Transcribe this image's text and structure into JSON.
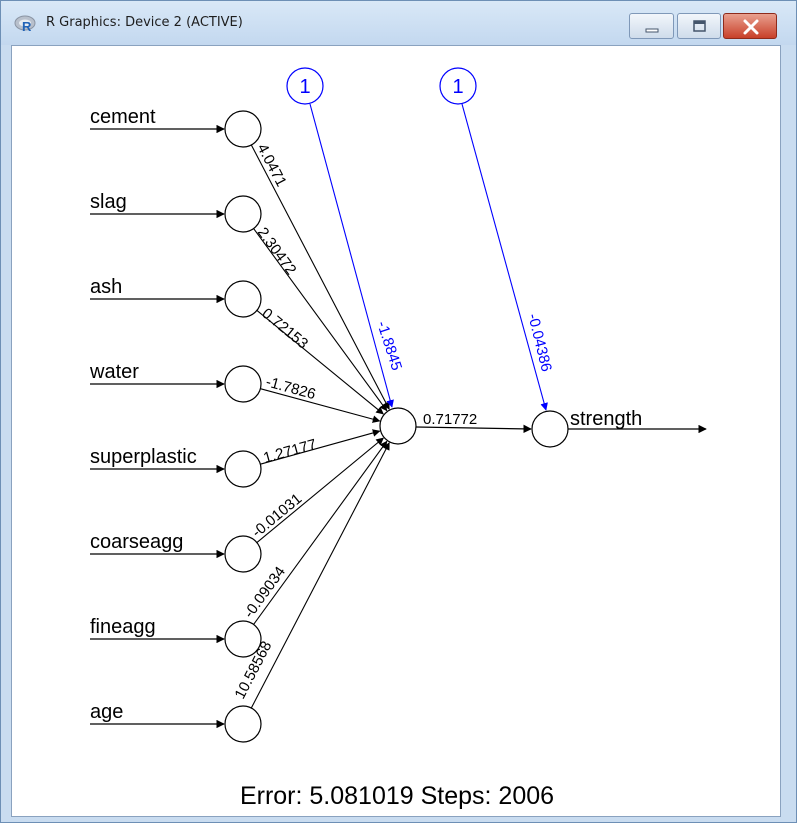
{
  "window": {
    "title": "R Graphics: Device 2 (ACTIVE)",
    "app_icon": "r-logo-icon",
    "controls": [
      "minimize-icon",
      "maximize-icon",
      "close-icon"
    ]
  },
  "network": {
    "inputs": [
      "cement",
      "slag",
      "ash",
      "water",
      "superplastic",
      "coarseagg",
      "fineagg",
      "age"
    ],
    "input_weights": [
      "4.0471",
      "2.30472",
      "0.72153",
      "-1.7826",
      "1.27177",
      "-0.01031",
      "-0.09034",
      "10.58568"
    ],
    "bias_labels": [
      "1",
      "1"
    ],
    "hidden_bias_weight": "-1.8845",
    "output_bias_weight": "-0.04386",
    "hidden_to_output_weight": "0.71772",
    "output": "strength",
    "bias_color": "#0000ff",
    "footer": "Error: 5.081019   Steps: 2006"
  }
}
